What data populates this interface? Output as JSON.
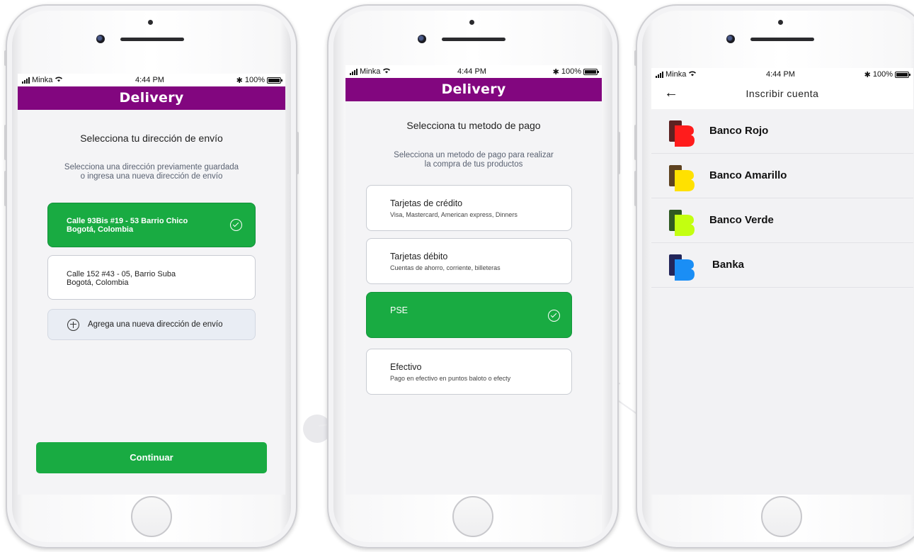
{
  "status_bar": {
    "carrier": "Minka",
    "time": "4:44 PM",
    "battery": "100%"
  },
  "screen1": {
    "app_title": "Delivery",
    "heading": "Selecciona tu dirección de envío",
    "subtitle_line1": "Selecciona una dirección previamente guardada",
    "subtitle_line2": "o ingresa una nueva dirección de envío",
    "addresses": [
      {
        "line1": "Calle 93Bis #19 - 53 Barrio Chico",
        "line2": "Bogotá, Colombia",
        "selected": true
      },
      {
        "line1": "Calle 152 #43 - 05, Barrio Suba",
        "line2": "Bogotá, Colombia",
        "selected": false
      }
    ],
    "add_address_label": "Agrega una  nueva dirección de envío",
    "continue_label": "Continuar"
  },
  "screen2": {
    "app_title": "Delivery",
    "heading": "Selecciona tu metodo de pago",
    "subtitle_line1": "Selecciona un metodo de pago para realizar",
    "subtitle_line2": "la compra de tus productos",
    "methods": [
      {
        "title": "Tarjetas de crédito",
        "subtitle": "Visa, Mastercard, American express, Dinners",
        "selected": false
      },
      {
        "title": "Tarjetas débito",
        "subtitle": "Cuentas de ahorro, corriente, billeteras",
        "selected": false
      },
      {
        "title": "PSE",
        "subtitle": "",
        "selected": true
      },
      {
        "title": "Efectivo",
        "subtitle": "Pago en efectivo en puntos baloto o efecty",
        "selected": false
      }
    ]
  },
  "screen3": {
    "title": "Inscribir cuenta",
    "back_icon": "arrow-left-icon",
    "banks": [
      {
        "name": "Banco Rojo",
        "color_dark": "#5c2222",
        "color": "#ff1c1c"
      },
      {
        "name": "Banco Amarillo",
        "color_dark": "#5e4220",
        "color": "#ffe100"
      },
      {
        "name": "Banco Verde",
        "color_dark": "#2f5a22",
        "color": "#c3ff10"
      },
      {
        "name": "Banka",
        "color_dark": "#23265a",
        "color": "#1a8ef5"
      }
    ]
  },
  "colors": {
    "brand": "#82067f",
    "accent": "#19ab42"
  }
}
